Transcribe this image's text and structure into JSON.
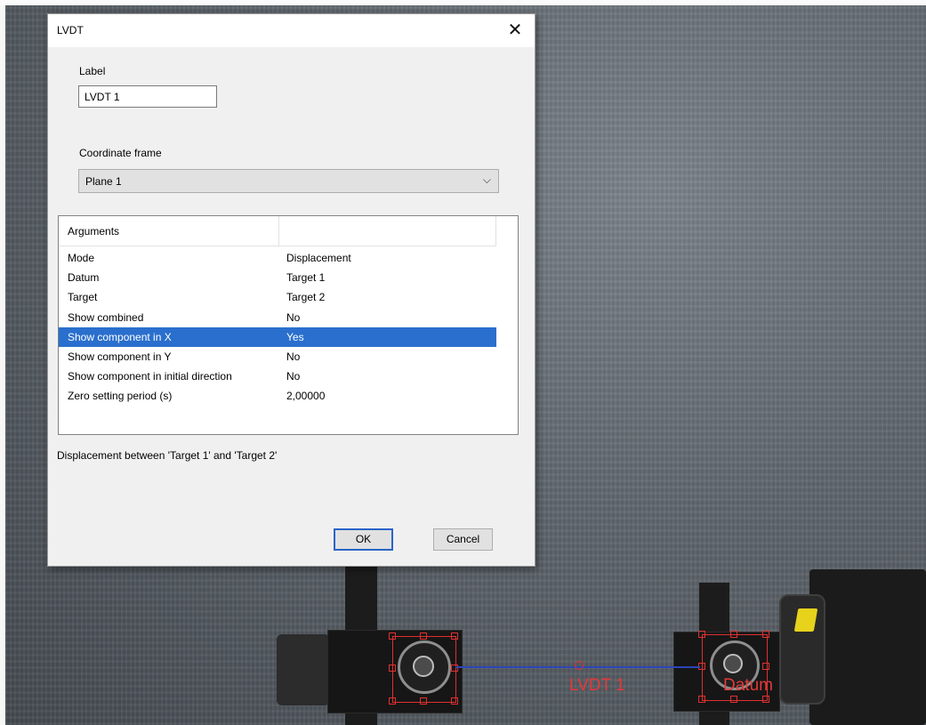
{
  "window": {
    "title": "LVDT",
    "close_glyph": "✕"
  },
  "label_field": {
    "label": "Label",
    "value": "LVDT 1"
  },
  "coordinate_frame": {
    "label": "Coordinate frame",
    "selected": "Plane 1",
    "arrow_glyph": "⌵"
  },
  "arguments": {
    "header": "Arguments",
    "rows": [
      {
        "key": "Mode",
        "value": "Displacement",
        "selected": false
      },
      {
        "key": "Datum",
        "value": "Target 1",
        "selected": false
      },
      {
        "key": "Target",
        "value": "Target 2",
        "selected": false
      },
      {
        "key": "Show combined",
        "value": "No",
        "selected": false
      },
      {
        "key": "Show component in X",
        "value": "Yes",
        "selected": true
      },
      {
        "key": "Show component in Y",
        "value": "No",
        "selected": false
      },
      {
        "key": "Show component in initial direction",
        "value": "No",
        "selected": false
      },
      {
        "key": "Zero setting period (s)",
        "value": "2,00000",
        "selected": false
      }
    ]
  },
  "description": "Displacement between 'Target 1' and 'Target 2'",
  "buttons": {
    "ok": "OK",
    "cancel": "Cancel"
  },
  "scene": {
    "measure_label": "LVDT 1",
    "datum_label": "Datum"
  },
  "colors": {
    "selection": "#2a6fcd",
    "marker": "#e03030",
    "measure_line": "#2e46b8",
    "ok_border": "#2b64c8"
  }
}
